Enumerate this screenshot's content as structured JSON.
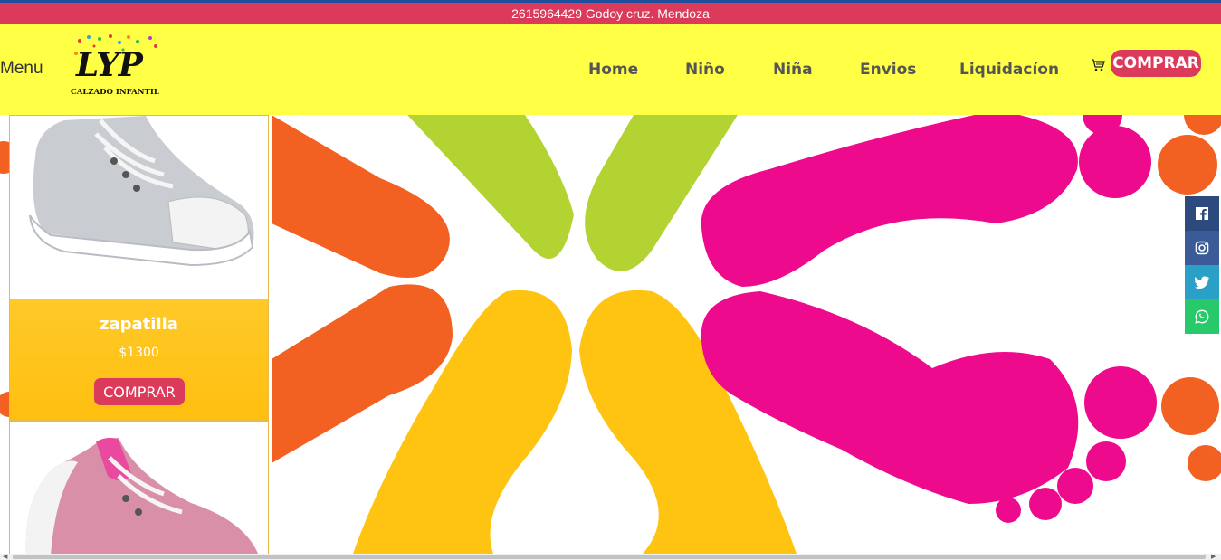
{
  "topbar": {
    "text": "2615964429 Godoy cruz. Mendoza"
  },
  "header": {
    "menu_label": "Menu",
    "logo": {
      "title": "LYP",
      "subtitle": "CALZADO INFANTIL"
    },
    "nav": [
      "Home",
      "Niño",
      "Niña",
      "Envios",
      "Liquidacíon"
    ],
    "cart_button": "COMPRAR"
  },
  "products": [
    {
      "title": "zapatilla",
      "price": "$1300",
      "button": "COMPRAR"
    }
  ],
  "social": [
    "facebook-icon",
    "instagram-icon",
    "twitter-icon",
    "whatsapp-icon"
  ],
  "colors": {
    "topbar": "#dc3a5b",
    "header": "#ffff45",
    "accent": "#dc3a5b",
    "card": "#ffc928",
    "facebook": "#2d4a7e",
    "instagram": "#3b5a98",
    "twitter": "#2aa0c9",
    "whatsapp": "#27c96b"
  }
}
